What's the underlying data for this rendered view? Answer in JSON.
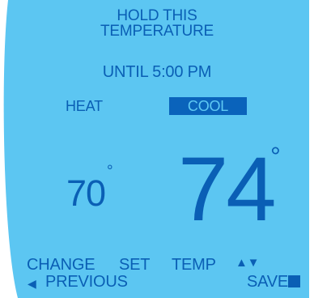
{
  "screen": {
    "hold_line1": "HOLD THIS",
    "hold_line2": "TEMPERATURE",
    "until": "UNTIL 5:00 PM"
  },
  "modes": {
    "heat": "HEAT",
    "cool": "COOL",
    "selected": "COOL"
  },
  "temps": {
    "current": "70",
    "current_degree": "°",
    "setpoint": "74",
    "setpoint_degree": "°"
  },
  "bottom": {
    "change": "CHANGE",
    "set": "SET",
    "temp": "TEMP",
    "arrows": "▲▼",
    "previous_arrow": "◀",
    "previous": "PREVIOUS",
    "save": "SAVE"
  },
  "colors": {
    "screen_background": "#5cc6f2",
    "text": "#0a5fb5",
    "highlight": "#0a63bb"
  },
  "icons": {
    "previous": "left-arrow-icon",
    "up_down": "up-down-arrows-icon",
    "stop": "square-stop-icon"
  }
}
